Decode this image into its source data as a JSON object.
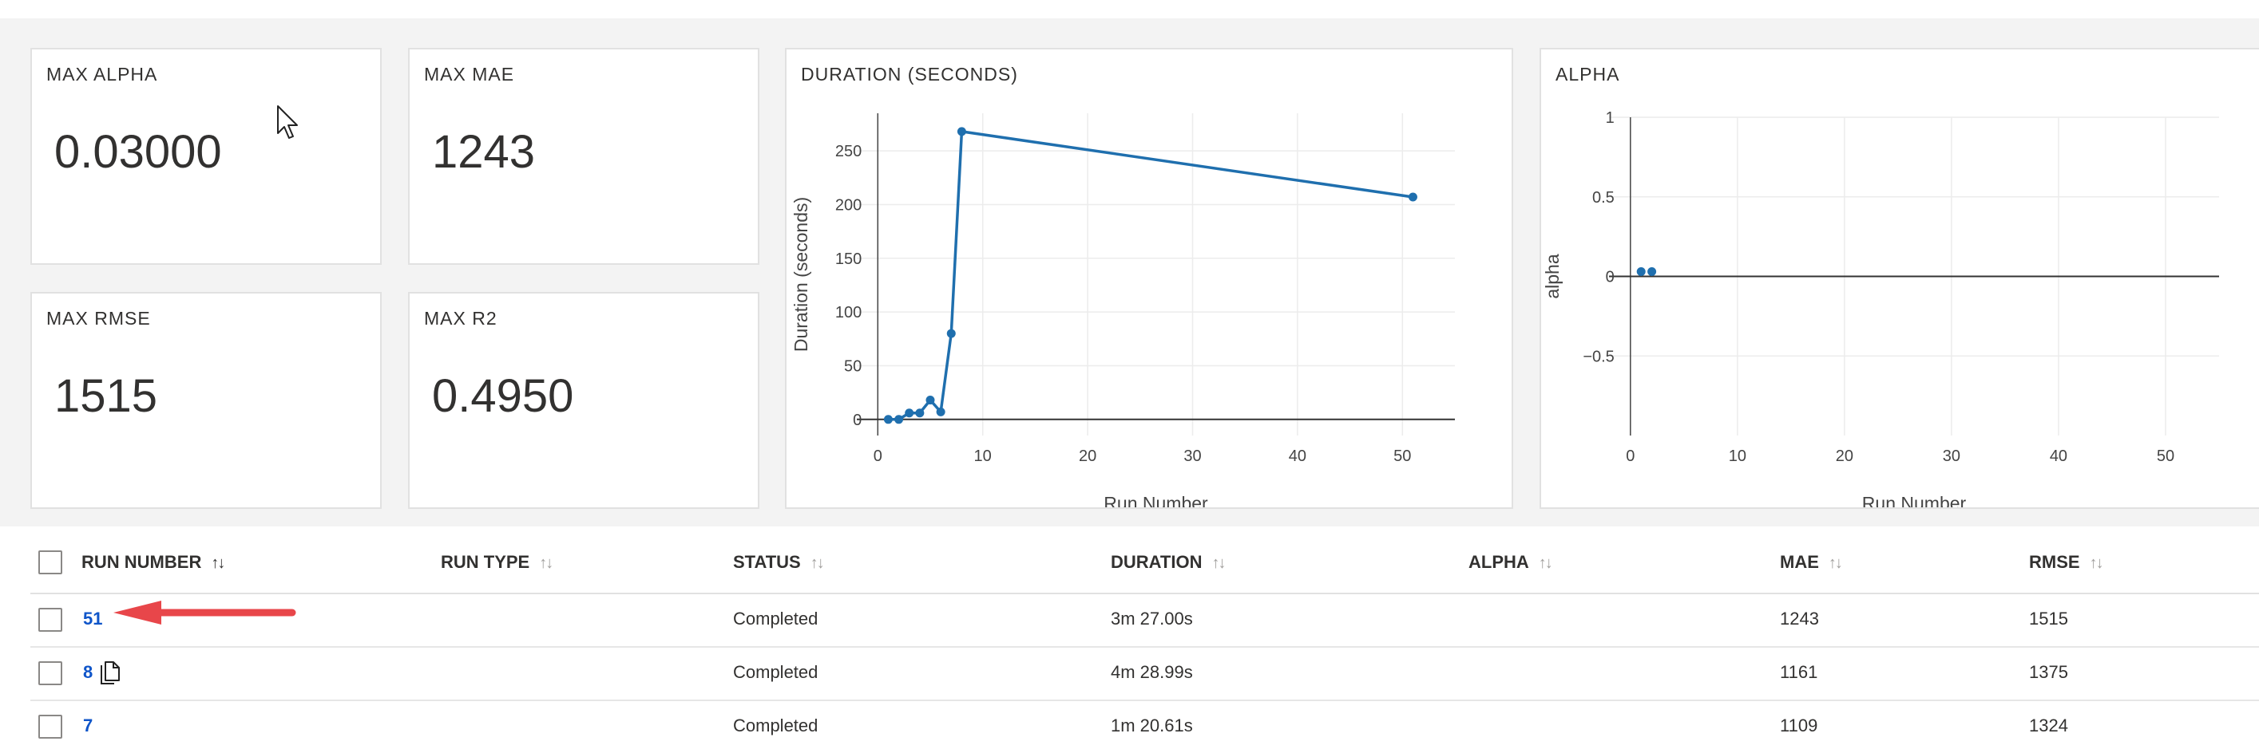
{
  "metrics": [
    {
      "title": "MAX ALPHA",
      "value": "0.03000"
    },
    {
      "title": "MAX MAE",
      "value": "1243"
    },
    {
      "title": "MAX RMSE",
      "value": "1515"
    },
    {
      "title": "MAX R2",
      "value": "0.4950"
    }
  ],
  "chart_data": [
    {
      "type": "line",
      "title": "DURATION (SECONDS)",
      "xlabel": "Run Number",
      "ylabel": "Duration (seconds)",
      "xlim": [
        -2,
        55
      ],
      "ylim": [
        -15,
        285
      ],
      "xticks": [
        0,
        10,
        20,
        30,
        40,
        50
      ],
      "yticks": [
        0,
        50,
        100,
        150,
        200,
        250
      ],
      "grid": true,
      "series": [
        {
          "color": "#1f6fae",
          "x": [
            1,
            2,
            3,
            4,
            5,
            6,
            7,
            8,
            51
          ],
          "y": [
            0,
            0,
            6,
            6,
            18,
            7,
            80,
            268,
            207
          ]
        }
      ]
    },
    {
      "type": "scatter",
      "title": "ALPHA",
      "xlabel": "Run Number",
      "ylabel": "alpha",
      "xlim": [
        -2,
        55
      ],
      "ylim": [
        -1,
        1
      ],
      "xticks": [
        0,
        10,
        20,
        30,
        40,
        50
      ],
      "yticks": [
        1,
        0.5,
        0,
        -0.5
      ],
      "ytick_labels": [
        "1",
        "0.5",
        "0",
        "−0.5"
      ],
      "grid": true,
      "series": [
        {
          "color": "#1f6fae",
          "x": [
            1,
            2
          ],
          "y": [
            0.03,
            0.03
          ]
        }
      ]
    }
  ],
  "table": {
    "headers": [
      "RUN NUMBER",
      "RUN TYPE",
      "STATUS",
      "DURATION",
      "ALPHA",
      "MAE",
      "RMSE"
    ],
    "rows": [
      {
        "run": "51",
        "type": "",
        "status": "Completed",
        "duration": "3m 27.00s",
        "alpha": "",
        "mae": "1243",
        "rmse": "1515"
      },
      {
        "run": "8",
        "type": "",
        "status": "Completed",
        "duration": "4m 28.99s",
        "alpha": "",
        "mae": "1161",
        "rmse": "1375"
      },
      {
        "run": "7",
        "type": "",
        "status": "Completed",
        "duration": "1m 20.61s",
        "alpha": "",
        "mae": "1109",
        "rmse": "1324"
      }
    ]
  },
  "colors": {
    "link": "#0f55c9",
    "series": "#1f6fae",
    "arrow": "#e8464a"
  },
  "icons": {
    "sort": "sort-arrows-icon",
    "copy": "copy-icon",
    "cursor": "mouse-pointer-icon",
    "annotation": "red-arrow"
  }
}
